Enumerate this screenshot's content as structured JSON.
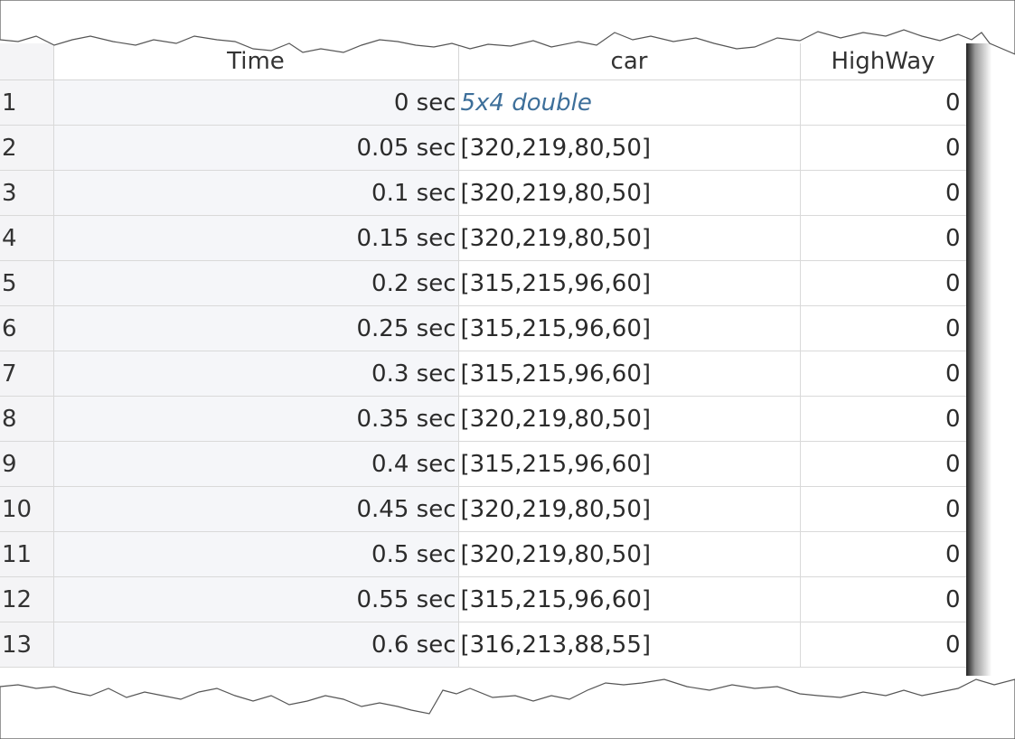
{
  "table": {
    "columns": [
      "",
      "Time",
      "car",
      "HighWay"
    ],
    "rows": [
      {
        "index": "1",
        "time": "0 sec",
        "car": "5x4 double",
        "car_italic": true,
        "highway": "0"
      },
      {
        "index": "2",
        "time": "0.05 sec",
        "car": "[320,219,80,50]",
        "highway": "0"
      },
      {
        "index": "3",
        "time": "0.1 sec",
        "car": "[320,219,80,50]",
        "highway": "0"
      },
      {
        "index": "4",
        "time": "0.15 sec",
        "car": "[320,219,80,50]",
        "highway": "0"
      },
      {
        "index": "5",
        "time": "0.2 sec",
        "car": "[315,215,96,60]",
        "highway": "0"
      },
      {
        "index": "6",
        "time": "0.25 sec",
        "car": "[315,215,96,60]",
        "highway": "0"
      },
      {
        "index": "7",
        "time": "0.3 sec",
        "car": "[315,215,96,60]",
        "highway": "0"
      },
      {
        "index": "8",
        "time": "0.35 sec",
        "car": "[320,219,80,50]",
        "highway": "0"
      },
      {
        "index": "9",
        "time": "0.4 sec",
        "car": "[315,215,96,60]",
        "highway": "0"
      },
      {
        "index": "10",
        "time": "0.45 sec",
        "car": "[320,219,80,50]",
        "highway": "0"
      },
      {
        "index": "11",
        "time": "0.5 sec",
        "car": "[320,219,80,50]",
        "highway": "0"
      },
      {
        "index": "12",
        "time": "0.55 sec",
        "car": "[315,215,96,60]",
        "highway": "0"
      },
      {
        "index": "13",
        "time": "0.6 sec",
        "car": "[316,213,88,55]",
        "highway": "0"
      }
    ]
  }
}
